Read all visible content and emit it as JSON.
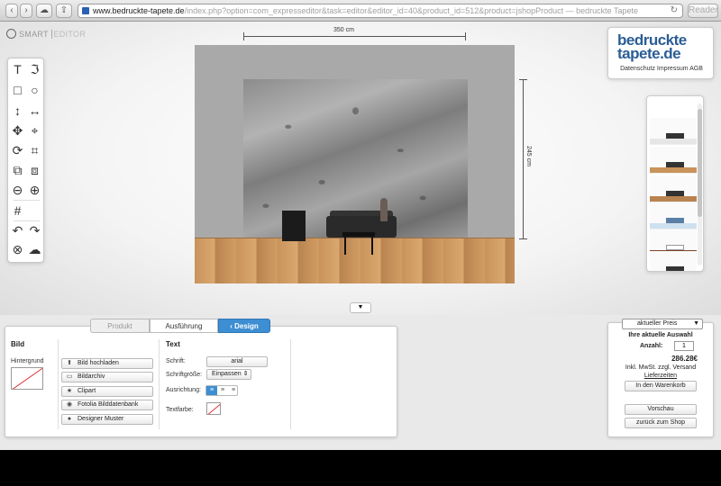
{
  "browser": {
    "url_main": "www.bedruckte-tapete.de",
    "url_rest": "/index.php?option=com_expresseditor&task=editor&editor_id=40&product_id=512&product=jshopProduct",
    "page_title": "— bedruckte Tapete",
    "reader_label": "Reader"
  },
  "app": {
    "logo_smart": "SMART",
    "logo_editor": "EDITOR"
  },
  "canvas": {
    "width_label": "350 cm",
    "height_label": "245 cm"
  },
  "brand": {
    "logo_line1": "bedruckte",
    "logo_line2": "tapete.de",
    "links": "Datenschutz Impressum AGB"
  },
  "tabs": {
    "produkt": "Produkt",
    "ausfuehrung": "Ausführung",
    "design": "Design"
  },
  "bild": {
    "heading": "Bild",
    "hintergrund_label": "Hintergrund",
    "buttons": [
      "Bild hochladen",
      "Bildarchiv",
      "Clipart",
      "Fotolia Bilddatenbank",
      "Designer Muster"
    ]
  },
  "text": {
    "heading": "Text",
    "schrift_label": "Schrift:",
    "schrift_value": "arial",
    "schriftgroesse_label": "Schriftgröße:",
    "schriftgroesse_value": "Einpassen",
    "ausrichtung_label": "Ausrichtung:",
    "textfarbe_label": "Textfarbe:"
  },
  "price": {
    "select_value": "aktueller Preis",
    "heading": "Ihre aktuelle Auswahl",
    "anzahl_label": "Anzahl:",
    "anzahl_value": "1",
    "amount": "286.28€",
    "tax_note": "Inkl. MwSt. zzgl. Versand",
    "lieferzeiten": "Lieferzeiten",
    "cart_button": "In den Warenkorb",
    "preview_button": "Vorschau",
    "back_button": "zurück zum Shop"
  },
  "colors": {
    "accent": "#3d8ed3",
    "brand": "#2a5d95"
  }
}
